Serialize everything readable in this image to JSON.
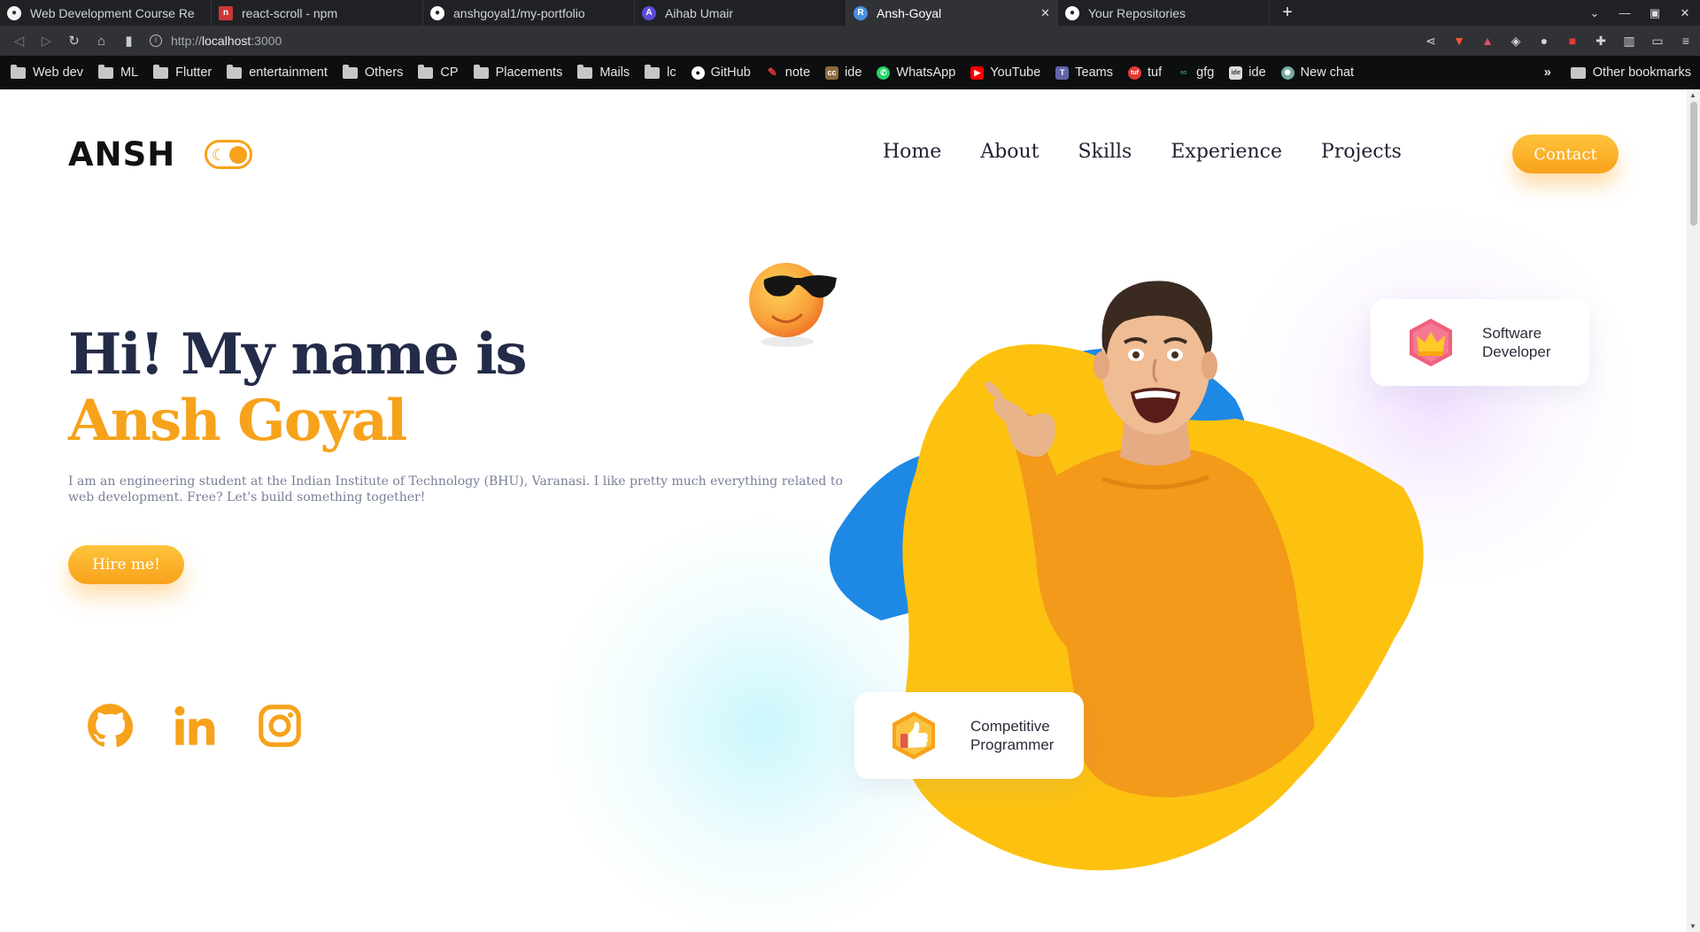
{
  "browser": {
    "tabs": [
      {
        "label": "Web Development Course Re",
        "fav_color": "#f4f4f4",
        "fav_glyph": "●"
      },
      {
        "label": "react-scroll - npm",
        "fav_color": "#cb3837",
        "fav_glyph": "n"
      },
      {
        "label": "anshgoyal1/my-portfolio",
        "fav_color": "#ffffff",
        "fav_glyph": "●"
      },
      {
        "label": "Aihab Umair",
        "fav_color": "#5b4cdb",
        "fav_glyph": "A"
      },
      {
        "label": "Ansh-Goyal",
        "fav_color": "#4a90e2",
        "fav_glyph": "R",
        "active": true,
        "close": "✕"
      },
      {
        "label": "Your Repositories",
        "fav_color": "#ffffff",
        "fav_glyph": "●"
      }
    ],
    "new_tab": "+",
    "window_controls": {
      "chevron": "⌄",
      "minimize": "—",
      "maximize": "▣",
      "close": "✕"
    },
    "url_scheme": "http://",
    "url_host": "localhost",
    "url_port": ":3000",
    "bookmarks": [
      {
        "label": "Web dev",
        "type": "folder"
      },
      {
        "label": "ML",
        "type": "folder"
      },
      {
        "label": "Flutter",
        "type": "folder"
      },
      {
        "label": "entertainment",
        "type": "folder"
      },
      {
        "label": "Others",
        "type": "folder"
      },
      {
        "label": "CP",
        "type": "folder"
      },
      {
        "label": "Placements",
        "type": "folder"
      },
      {
        "label": "Mails",
        "type": "folder"
      },
      {
        "label": "lc",
        "type": "folder"
      },
      {
        "label": "GitHub",
        "type": "link",
        "color": "#ffffff",
        "icon": "github-icon"
      },
      {
        "label": "note",
        "type": "link",
        "color": "#e53935",
        "icon": "pin-icon"
      },
      {
        "label": "ide",
        "type": "link",
        "color": "#8a6d3b",
        "icon": "cc-icon"
      },
      {
        "label": "WhatsApp",
        "type": "link",
        "color": "#25d366",
        "icon": "whatsapp-icon"
      },
      {
        "label": "YouTube",
        "type": "link",
        "color": "#ff0000",
        "icon": "youtube-icon"
      },
      {
        "label": "Teams",
        "type": "link",
        "color": "#6264a7",
        "icon": "teams-icon"
      },
      {
        "label": "tuf",
        "type": "link",
        "color": "#e53935",
        "icon": "tuf-icon"
      },
      {
        "label": "gfg",
        "type": "link",
        "color": "#2f8d46",
        "icon": "gfg-icon"
      },
      {
        "label": "ide",
        "type": "link",
        "color": "#dddddd",
        "icon": "ide-icon"
      },
      {
        "label": "New chat",
        "type": "link",
        "color": "#74aa9c",
        "icon": "chatgpt-icon"
      }
    ],
    "bookmarks_more": "»",
    "other_bookmarks": "Other bookmarks"
  },
  "page": {
    "logo": "ANSH",
    "nav": [
      "Home",
      "About",
      "Skills",
      "Experience",
      "Projects"
    ],
    "contact": "Contact",
    "hero": {
      "line1": "Hi! My name is",
      "name": "Ansh Goyal",
      "description": "I am an engineering student at the Indian Institute of Technology (BHU), Varanasi. I like pretty much everything related to web development. Free? Let's build something together!",
      "hire": "Hire me!"
    },
    "cards": {
      "software": [
        "Software",
        "Developer"
      ],
      "cp": [
        "Competitive",
        "Programmer"
      ]
    },
    "colors": {
      "accent": "#f7a21b",
      "heading": "#242b48",
      "blob_yellow": "#fdc20f",
      "blob_blue": "#1e88e5"
    }
  }
}
